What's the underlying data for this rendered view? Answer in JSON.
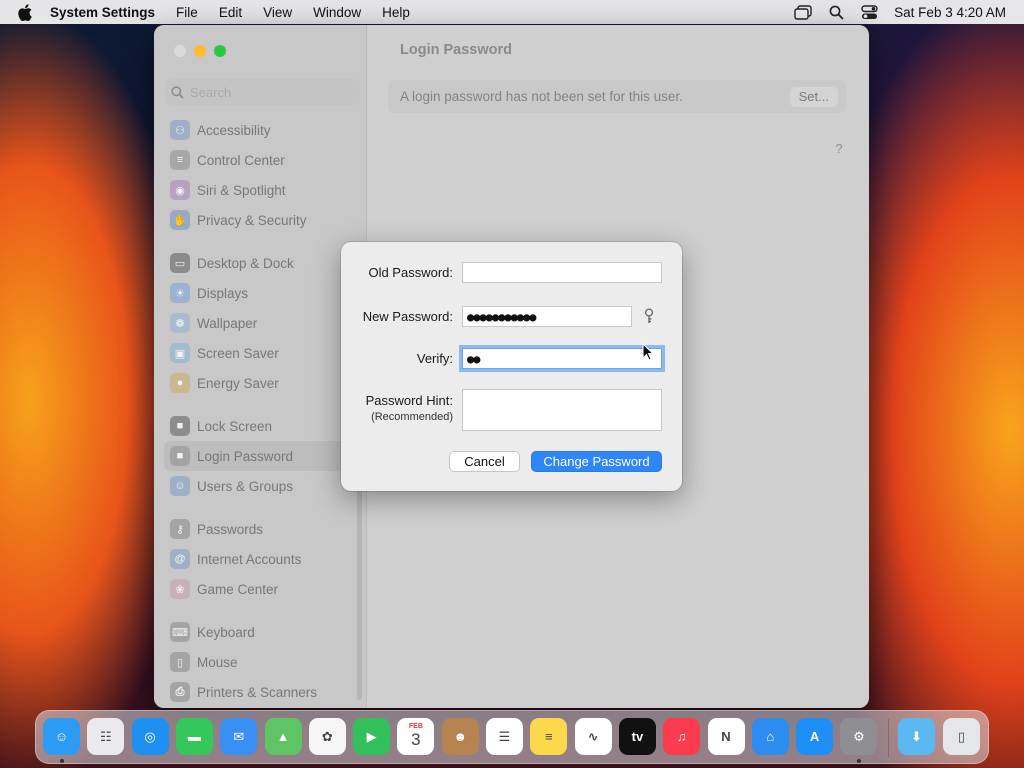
{
  "menubar": {
    "app_name": "System Settings",
    "menus": [
      "File",
      "Edit",
      "View",
      "Window",
      "Help"
    ],
    "clock": "Sat Feb 3  4:20 AM"
  },
  "window": {
    "title": "Login Password",
    "search_placeholder": "Search",
    "info_text": "A login password has not been set for this user.",
    "set_button": "Set...",
    "help_button": "?"
  },
  "sidebar": {
    "groups": [
      [
        {
          "label": "Accessibility",
          "icon": "accessibility-icon",
          "color": "#9fb0c6",
          "glyph": "⚇"
        },
        {
          "label": "Control Center",
          "icon": "control-center-icon",
          "color": "#a6a6a6",
          "glyph": "≡"
        },
        {
          "label": "Siri & Spotlight",
          "icon": "siri-icon",
          "color": "#b7a2bf",
          "glyph": "◉"
        },
        {
          "label": "Privacy & Security",
          "icon": "hand-icon",
          "color": "#98a9c4",
          "glyph": "✋"
        }
      ],
      [
        {
          "label": "Desktop & Dock",
          "icon": "desktop-dock-icon",
          "color": "#8b8b8b",
          "glyph": "▭"
        },
        {
          "label": "Displays",
          "icon": "displays-icon",
          "color": "#9bb3cf",
          "glyph": "☀"
        },
        {
          "label": "Wallpaper",
          "icon": "wallpaper-icon",
          "color": "#a9bccf",
          "glyph": "❁"
        },
        {
          "label": "Screen Saver",
          "icon": "screen-saver-icon",
          "color": "#a3bccb",
          "glyph": "▣"
        },
        {
          "label": "Energy Saver",
          "icon": "energy-saver-icon",
          "color": "#c9b78f",
          "glyph": "●"
        }
      ],
      [
        {
          "label": "Lock Screen",
          "icon": "lock-icon",
          "color": "#8d8d8d",
          "glyph": "■"
        },
        {
          "label": "Login Password",
          "icon": "padlock-icon",
          "color": "#a4a4a4",
          "glyph": "■",
          "selected": true
        },
        {
          "label": "Users & Groups",
          "icon": "users-icon",
          "color": "#9fb0c6",
          "glyph": "☺"
        }
      ],
      [
        {
          "label": "Passwords",
          "icon": "key-icon",
          "color": "#a4a4a4",
          "glyph": "⚷"
        },
        {
          "label": "Internet Accounts",
          "icon": "at-icon",
          "color": "#9fb0c6",
          "glyph": "@"
        },
        {
          "label": "Game Center",
          "icon": "game-center-icon",
          "color": "#c8b0b8",
          "glyph": "❀"
        }
      ],
      [
        {
          "label": "Keyboard",
          "icon": "keyboard-icon",
          "color": "#a4a4a4",
          "glyph": "⌨"
        },
        {
          "label": "Mouse",
          "icon": "mouse-icon",
          "color": "#a4a4a4",
          "glyph": "▯"
        },
        {
          "label": "Printers & Scanners",
          "icon": "printer-icon",
          "color": "#a4a4a4",
          "glyph": "⎙"
        }
      ]
    ]
  },
  "dialog": {
    "old_label": "Old Password:",
    "old_value": "",
    "new_label": "New Password:",
    "new_value": "●●●●●●●●●●●",
    "verify_label": "Verify:",
    "verify_value": "●●",
    "hint_label": "Password Hint:",
    "hint_sub": "(Recommended)",
    "hint_value": "",
    "cancel": "Cancel",
    "submit": "Change Password"
  },
  "dock": {
    "apps": [
      {
        "name": "finder-icon",
        "color": "#2b9bf3",
        "glyph": "☺",
        "running": true
      },
      {
        "name": "launchpad-icon",
        "color": "#e9e9ee",
        "glyph": "☷"
      },
      {
        "name": "safari-icon",
        "color": "#1f8ff0",
        "glyph": "◎"
      },
      {
        "name": "messages-icon",
        "color": "#34c759",
        "glyph": "▬"
      },
      {
        "name": "mail-icon",
        "color": "#3a8ff5",
        "glyph": "✉"
      },
      {
        "name": "maps-icon",
        "color": "#5fc463",
        "glyph": "▲"
      },
      {
        "name": "photos-icon",
        "color": "#f6f6f6",
        "glyph": "✿"
      },
      {
        "name": "facetime-icon",
        "color": "#31c05a",
        "glyph": "▶"
      },
      {
        "name": "calendar-icon",
        "color": "#ffffff",
        "glyph": "3",
        "sub": "FEB"
      },
      {
        "name": "contacts-icon",
        "color": "#b48350",
        "glyph": "☻"
      },
      {
        "name": "reminders-icon",
        "color": "#ffffff",
        "glyph": "☰"
      },
      {
        "name": "notes-icon",
        "color": "#fbd94a",
        "glyph": "≡"
      },
      {
        "name": "freeform-icon",
        "color": "#ffffff",
        "glyph": "∿"
      },
      {
        "name": "tv-icon",
        "color": "#111111",
        "glyph": "tv"
      },
      {
        "name": "music-icon",
        "color": "#fb3c4e",
        "glyph": "♫"
      },
      {
        "name": "news-icon",
        "color": "#ffffff",
        "glyph": "N"
      },
      {
        "name": "keynote-icon",
        "color": "#2d8cf0",
        "glyph": "⌂"
      },
      {
        "name": "app-store-icon",
        "color": "#1d8ff5",
        "glyph": "A"
      },
      {
        "name": "system-settings-icon",
        "color": "#8e8e93",
        "glyph": "⚙",
        "running": true
      },
      {
        "name": "downloads-folder-icon",
        "color": "#5cb8f0",
        "glyph": "⬇"
      },
      {
        "name": "trash-icon",
        "color": "#e4e6ea",
        "glyph": "▯"
      }
    ]
  }
}
